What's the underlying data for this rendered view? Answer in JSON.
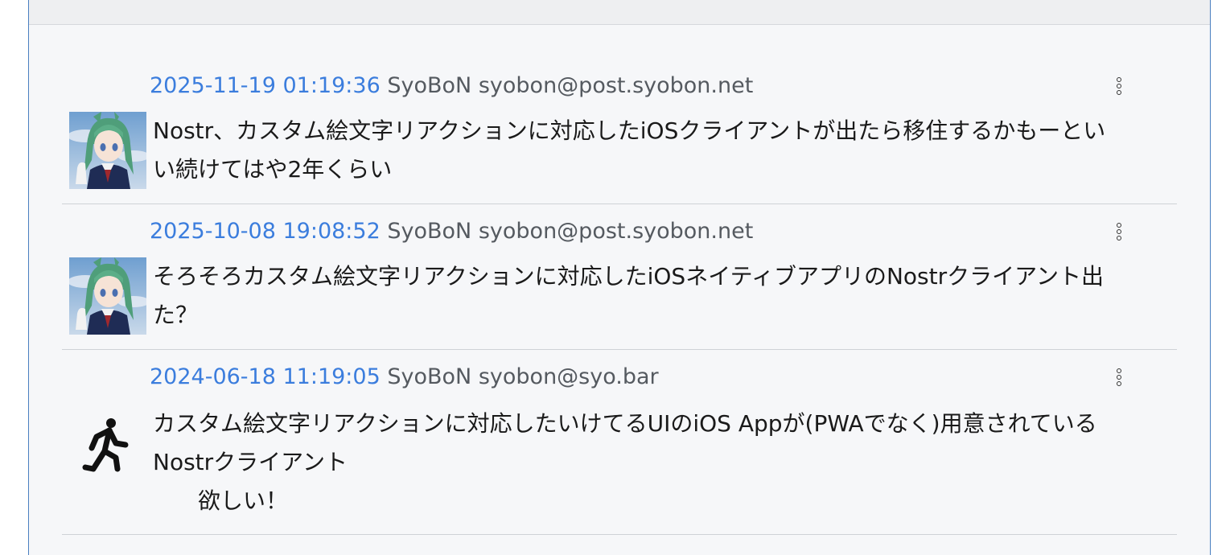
{
  "posts": [
    {
      "date": "2025-11-19 01:19:36",
      "name": "SyoBoN",
      "handle": "syobon@post.syobon.net",
      "avatar": "anime-avatar",
      "text": "Nostr、カスタム絵文字リアクションに対応したiOSクライアントが出たら移住するかもーとい\nい続けてはや2年くらい"
    },
    {
      "date": "2025-10-08 19:08:52",
      "name": "SyoBoN",
      "handle": "syobon@post.syobon.net",
      "avatar": "anime-avatar",
      "text": "そろそろカスタム絵文字リアクションに対応したiOSネイティブアプリのNostrクライアント出\nた？"
    },
    {
      "date": "2024-06-18 11:19:05",
      "name": "SyoBoN",
      "handle": "syobon@syo.bar",
      "avatar": "running-person-icon",
      "text": "カスタム絵文字リアクションに対応したいけてるUIのiOS Appが(PWAでなく)用意されている\nNostrクライアント\n　　欲しい！"
    }
  ],
  "colors": {
    "link": "#3b7ddd",
    "meta": "#555a60",
    "border": "#4a7fc0"
  }
}
